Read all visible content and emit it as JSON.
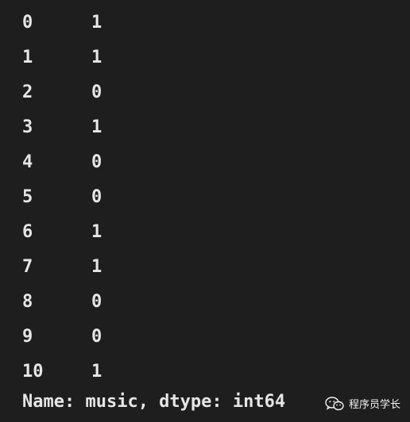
{
  "series": {
    "rows": [
      {
        "index": "0",
        "value": "1"
      },
      {
        "index": "1",
        "value": "1"
      },
      {
        "index": "2",
        "value": "0"
      },
      {
        "index": "3",
        "value": "1"
      },
      {
        "index": "4",
        "value": "0"
      },
      {
        "index": "5",
        "value": "0"
      },
      {
        "index": "6",
        "value": "1"
      },
      {
        "index": "7",
        "value": "1"
      },
      {
        "index": "8",
        "value": "0"
      },
      {
        "index": "9",
        "value": "0"
      },
      {
        "index": "10",
        "value": "1"
      }
    ],
    "footer": "Name: music, dtype: int64"
  },
  "watermark": {
    "icon": "wechat-icon",
    "text": "程序员学长"
  },
  "colors": {
    "background": "#1e1e1e",
    "text": "#e6e6e6"
  }
}
